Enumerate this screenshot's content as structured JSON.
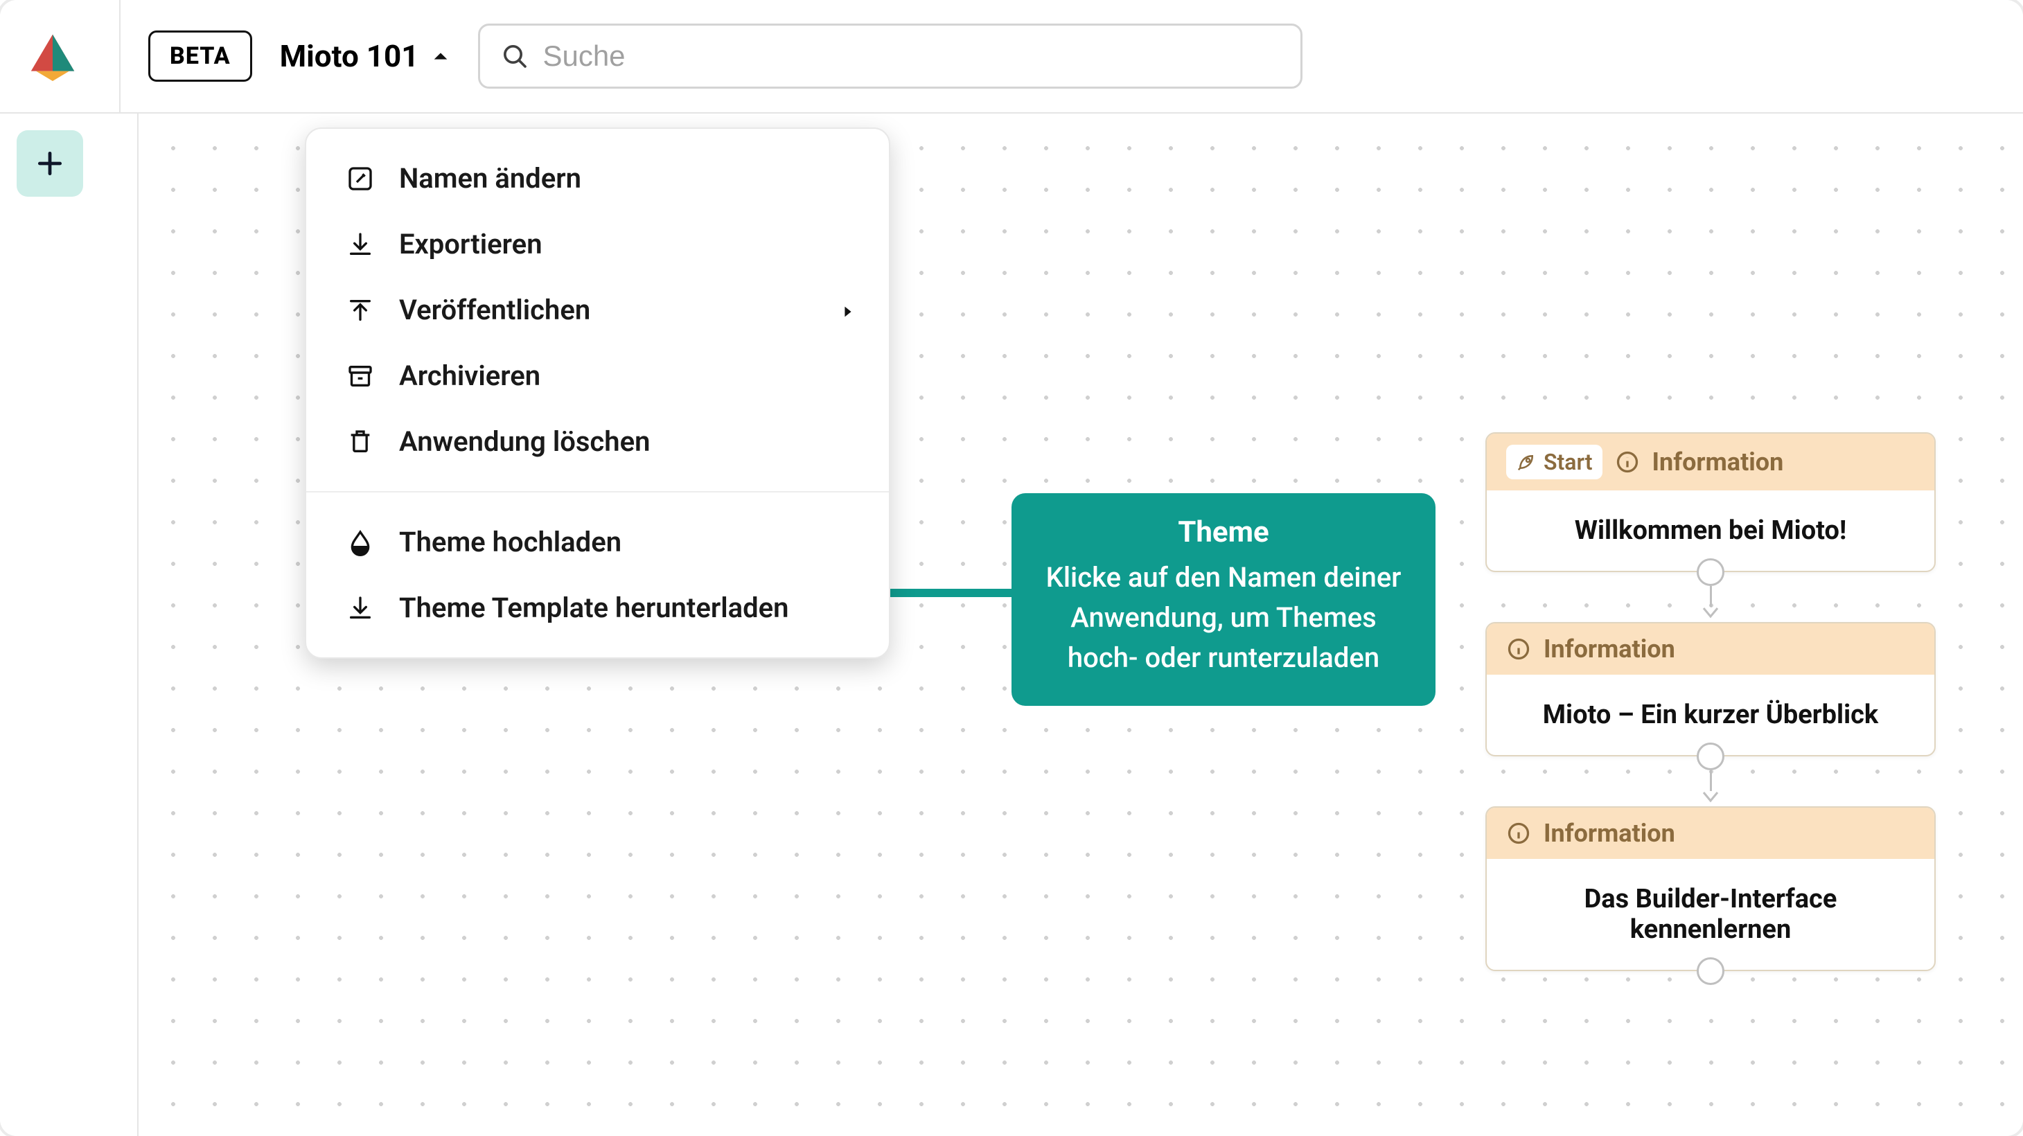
{
  "header": {
    "beta_label": "BETA",
    "app_title": "Mioto 101",
    "search_placeholder": "Suche"
  },
  "menu": {
    "section1": [
      {
        "key": "rename",
        "label": "Namen ändern"
      },
      {
        "key": "export",
        "label": "Exportieren"
      },
      {
        "key": "publish",
        "label": "Veröffentlichen",
        "submenu": true
      },
      {
        "key": "archive",
        "label": "Archivieren"
      },
      {
        "key": "delete",
        "label": "Anwendung löschen"
      }
    ],
    "section2": [
      {
        "key": "theme_upload",
        "label": "Theme hochladen"
      },
      {
        "key": "theme_download",
        "label": "Theme Template herunterladen"
      }
    ]
  },
  "callout": {
    "title": "Theme",
    "body": "Klicke auf den Namen deiner Anwendung, um Themes hoch- oder runterzuladen"
  },
  "flow": {
    "nodes": [
      {
        "start": true,
        "type_label": "Information",
        "title": "Willkommen bei Mioto!"
      },
      {
        "start": false,
        "type_label": "Information",
        "title": "Mioto – Ein kurzer Überblick"
      },
      {
        "start": false,
        "type_label": "Information",
        "title": "Das Builder-Interface kennenlernen"
      }
    ],
    "start_label": "Start"
  },
  "colors": {
    "accent_teal": "#0f9b8e",
    "add_button_bg": "#cdeee8",
    "node_header_bg": "#fbe1c0",
    "node_header_fg": "#8b6b3e"
  }
}
